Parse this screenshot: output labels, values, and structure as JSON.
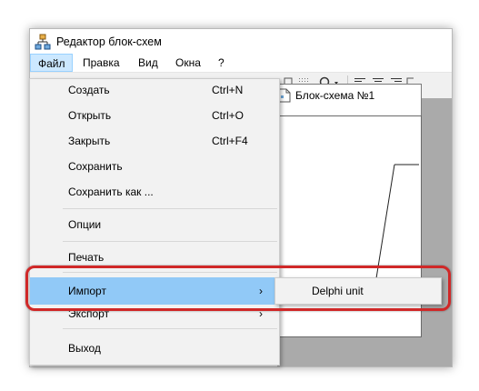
{
  "window": {
    "title": "Редактор блок-схем"
  },
  "menubar": [
    "Файл",
    "Правка",
    "Вид",
    "Окна",
    "?"
  ],
  "file_menu": {
    "items": [
      {
        "label": "Создать",
        "shortcut": "Ctrl+N"
      },
      {
        "label": "Открыть",
        "shortcut": "Ctrl+O"
      },
      {
        "label": "Закрыть",
        "shortcut": "Ctrl+F4"
      },
      {
        "label": "Сохранить",
        "shortcut": ""
      },
      {
        "label": "Сохранить как ...",
        "shortcut": ""
      },
      {
        "label": "Опции",
        "shortcut": ""
      },
      {
        "label": "Печать",
        "shortcut": ""
      },
      {
        "label": "Импорт",
        "arrow": "›"
      },
      {
        "label": "Экспорт",
        "arrow": "›"
      },
      {
        "label": "Выход",
        "shortcut": ""
      }
    ]
  },
  "import_submenu": {
    "items": [
      "Delphi unit"
    ]
  },
  "child_window": {
    "title": "Блок-схема №1"
  },
  "colors": {
    "highlight": "#91c9f7",
    "callout": "#d02828",
    "menu_active": "#cce8ff"
  },
  "icons": [
    "flowchart-app-icon",
    "dotted-grid-icon",
    "zoom-icon",
    "align-left-icon",
    "align-center-icon",
    "align-right-icon",
    "document-icon"
  ]
}
